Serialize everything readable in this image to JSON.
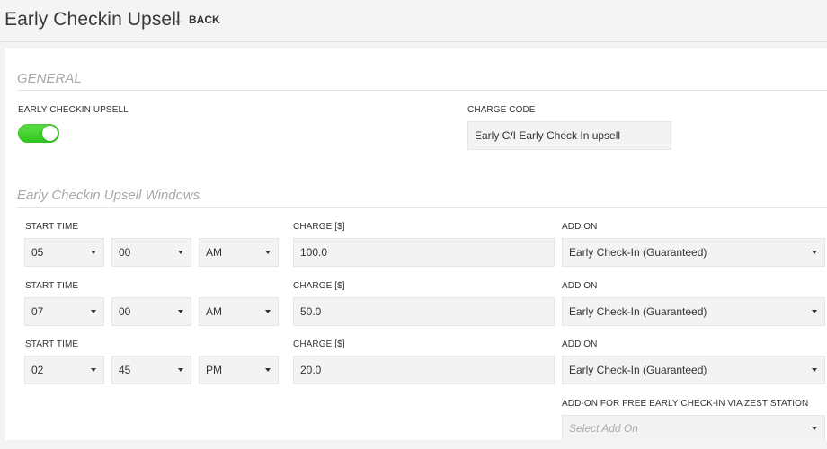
{
  "header": {
    "title": "Early Checkin Upsell",
    "back_label": "BACK"
  },
  "general": {
    "section_title": "GENERAL",
    "toggle_label": "EARLY CHECKIN UPSELL",
    "toggle_on": true,
    "charge_code_label": "CHARGE CODE",
    "charge_code_value": "Early C/I Early Check In upsell"
  },
  "windows": {
    "section_title": "Early Checkin Upsell Windows",
    "start_time_label": "START TIME",
    "charge_label": "CHARGE [$]",
    "add_on_label": "ADD ON",
    "rows": [
      {
        "hour": "05",
        "minute": "00",
        "ampm": "AM",
        "charge": "100.0",
        "add_on": "Early Check-In (Guaranteed)"
      },
      {
        "hour": "07",
        "minute": "00",
        "ampm": "AM",
        "charge": "50.0",
        "add_on": "Early Check-In (Guaranteed)"
      },
      {
        "hour": "02",
        "minute": "45",
        "ampm": "PM",
        "charge": "20.0",
        "add_on": "Early Check-In (Guaranteed)"
      }
    ],
    "zest_label": "ADD-ON FOR FREE EARLY CHECK-IN VIA ZEST STATION",
    "zest_placeholder": "Select Add On"
  },
  "colors": {
    "toggle_on": "#2fc51d",
    "section_title": "#a8a8a8",
    "field_bg": "#f3f3f3"
  },
  "icons": {
    "back": "left-arrow-icon",
    "dropdown": "caret-down-icon"
  }
}
